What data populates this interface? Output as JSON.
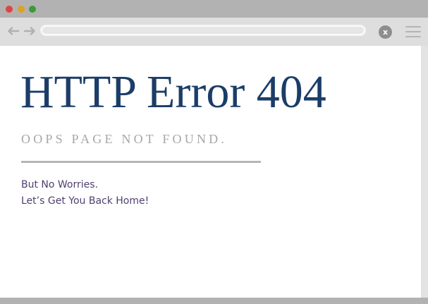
{
  "window": {
    "controls": [
      {
        "name": "close",
        "color": "#e0443e"
      },
      {
        "name": "minimize",
        "color": "#dea123"
      },
      {
        "name": "maximize",
        "color": "#3c9a3a"
      }
    ]
  },
  "toolbar": {
    "back_icon": "left-arrow-icon",
    "forward_icon": "right-arrow-icon",
    "address_value": "",
    "close_label": "x",
    "menu_icon": "hamburger-menu-icon"
  },
  "page": {
    "title": "HTTP Error 404",
    "subtitle": "OOPS PAGE NOT FOUND.",
    "message_line1": "But No Worries.",
    "message_line2": "Let’s Get You Back Home!"
  },
  "colors": {
    "titlebar": "#b2b2b2",
    "toolbar": "#dedede",
    "title_text": "#1b3d68",
    "subtitle_text": "#a7a7a7",
    "message_text": "#4e3f6e",
    "divider": "#b6b6b6"
  }
}
